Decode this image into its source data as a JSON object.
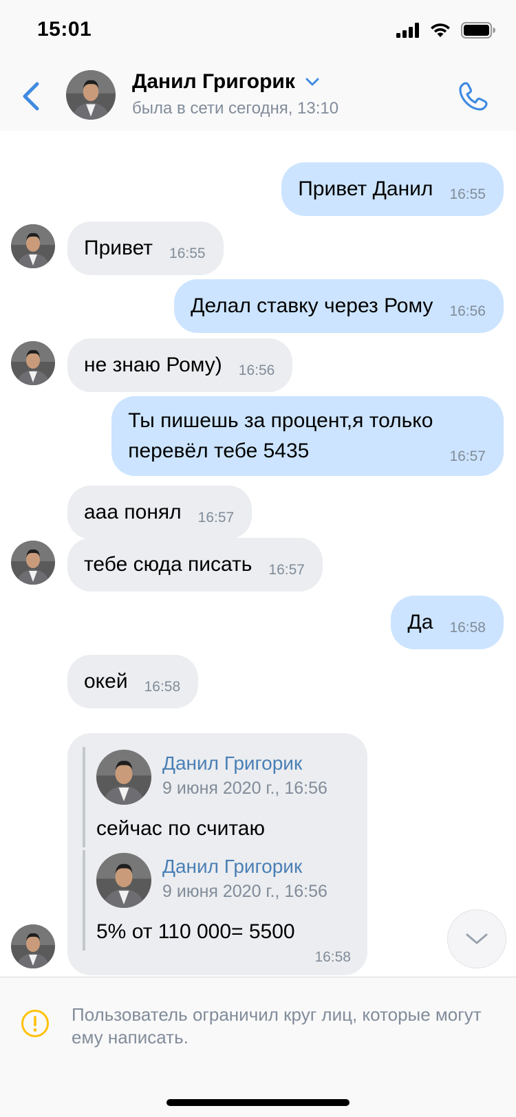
{
  "status_bar": {
    "time": "15:01"
  },
  "header": {
    "name": "Данил Григорик",
    "status": "была в сети сегодня, 13:10"
  },
  "messages": [
    {
      "dir": "out",
      "text": "Привет Данил",
      "time": "16:55"
    },
    {
      "dir": "in",
      "text": "Привет",
      "time": "16:55"
    },
    {
      "dir": "out",
      "text": "Делал ставку через Рому",
      "time": "16:56"
    },
    {
      "dir": "in",
      "text": "не знаю Рому)",
      "time": "16:56"
    },
    {
      "dir": "out",
      "text": "Ты пишешь за процент,я только\nперевёл тебе 5435",
      "time": "16:57"
    },
    {
      "dir": "in",
      "text": "ааа понял",
      "time": "16:57"
    },
    {
      "dir": "in",
      "text": "тебе сюда писать",
      "time": "16:57"
    },
    {
      "dir": "out",
      "text": "Да",
      "time": "16:58"
    },
    {
      "dir": "in",
      "text": "окей",
      "time": "16:58"
    }
  ],
  "forwarded": {
    "items": [
      {
        "name": "Данил Григорик",
        "date": "9 июня 2020 г., 16:56",
        "text": "сейчас по считаю"
      },
      {
        "name": "Данил Григорик",
        "date": "9 июня 2020 г., 16:56",
        "text": "5% от 110 000= 5500"
      }
    ],
    "time": "16:58"
  },
  "restriction": {
    "text": "Пользователь ограничил круг лиц, которые могут ему написать."
  },
  "colors": {
    "accent": "#3f8ae0",
    "outgoing_bubble": "#cce4ff",
    "incoming_bubble": "#ebedf0",
    "warning": "#ffc107",
    "secondary_text": "#818c99"
  },
  "icons": [
    "back-arrow-icon",
    "chevron-down-icon",
    "phone-icon",
    "signal-icon",
    "wifi-icon",
    "battery-icon",
    "warning-icon"
  ]
}
